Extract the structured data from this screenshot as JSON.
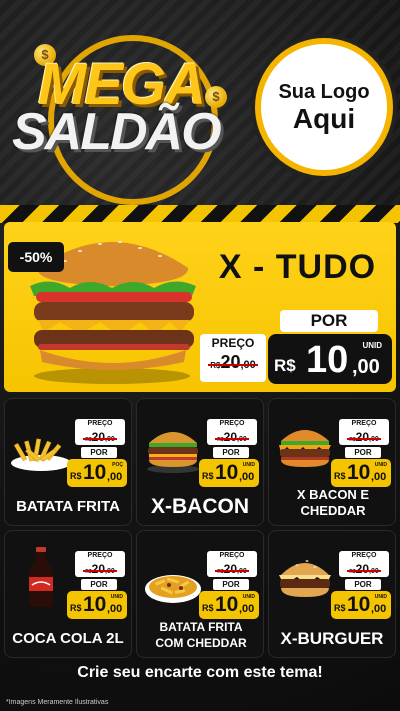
{
  "header": {
    "title_line1": "MEGA",
    "title_line2": "SALDÃO",
    "coin_symbol": "$",
    "logo_line1": "Sua Logo",
    "logo_line2": "Aqui"
  },
  "colors": {
    "accent": "#f5c400",
    "dark": "#111111",
    "price_strike": "#cc0000"
  },
  "featured": {
    "discount": "-50%",
    "name": "X - TUDO",
    "por_label": "POR",
    "preco_label": "PREÇO",
    "old_currency": "R$",
    "old_int": "20",
    "old_cents": ",00",
    "unid_label": "UNID",
    "new_currency": "R$",
    "new_int": "10",
    "new_cents": ",00"
  },
  "products": [
    {
      "name": "BATATA FRITA",
      "icon": "fries-icon",
      "preco_label": "PREÇO",
      "old_currency": "R$",
      "old_int": "20",
      "old_cents": ",00",
      "por_label": "POR",
      "unid_label": "POÇ",
      "new_currency": "R$",
      "new_int": "10",
      "new_cents": ",00"
    },
    {
      "name": "X-BACON",
      "icon": "burger-icon",
      "preco_label": "PREÇO",
      "old_currency": "R$",
      "old_int": "20",
      "old_cents": ",00",
      "por_label": "POR",
      "unid_label": "UNID",
      "new_currency": "R$",
      "new_int": "10",
      "new_cents": ",00"
    },
    {
      "name": "X BACON E CHEDDAR",
      "icon": "cheddar-burger-icon",
      "preco_label": "PREÇO",
      "old_currency": "R$",
      "old_int": "20",
      "old_cents": ",00",
      "por_label": "POR",
      "unid_label": "UNID",
      "new_currency": "R$",
      "new_int": "10",
      "new_cents": ",00"
    },
    {
      "name": "COCA COLA 2L",
      "icon": "soda-bottle-icon",
      "preco_label": "PREÇO",
      "old_currency": "R$",
      "old_int": "20",
      "old_cents": ",00",
      "por_label": "POR",
      "unid_label": "UNID",
      "new_currency": "R$",
      "new_int": "10",
      "new_cents": ",00"
    },
    {
      "name": "BATATA FRITA COM CHEDDAR",
      "icon": "cheddar-fries-icon",
      "preco_label": "PREÇO",
      "old_currency": "R$",
      "old_int": "20",
      "old_cents": ",00",
      "por_label": "POR",
      "unid_label": "UNID",
      "new_currency": "R$",
      "new_int": "10",
      "new_cents": ",00"
    },
    {
      "name": "X-BURGUER",
      "icon": "cheeseburger-icon",
      "preco_label": "PREÇO",
      "old_currency": "R$",
      "old_int": "20",
      "old_cents": ",00",
      "por_label": "POR",
      "unid_label": "UNID",
      "new_currency": "R$",
      "new_int": "10",
      "new_cents": ",00"
    }
  ],
  "footer": {
    "cta": "Crie seu encarte com este tema!",
    "disclaimer": "*Imagens Meramente Ilustrativas"
  }
}
